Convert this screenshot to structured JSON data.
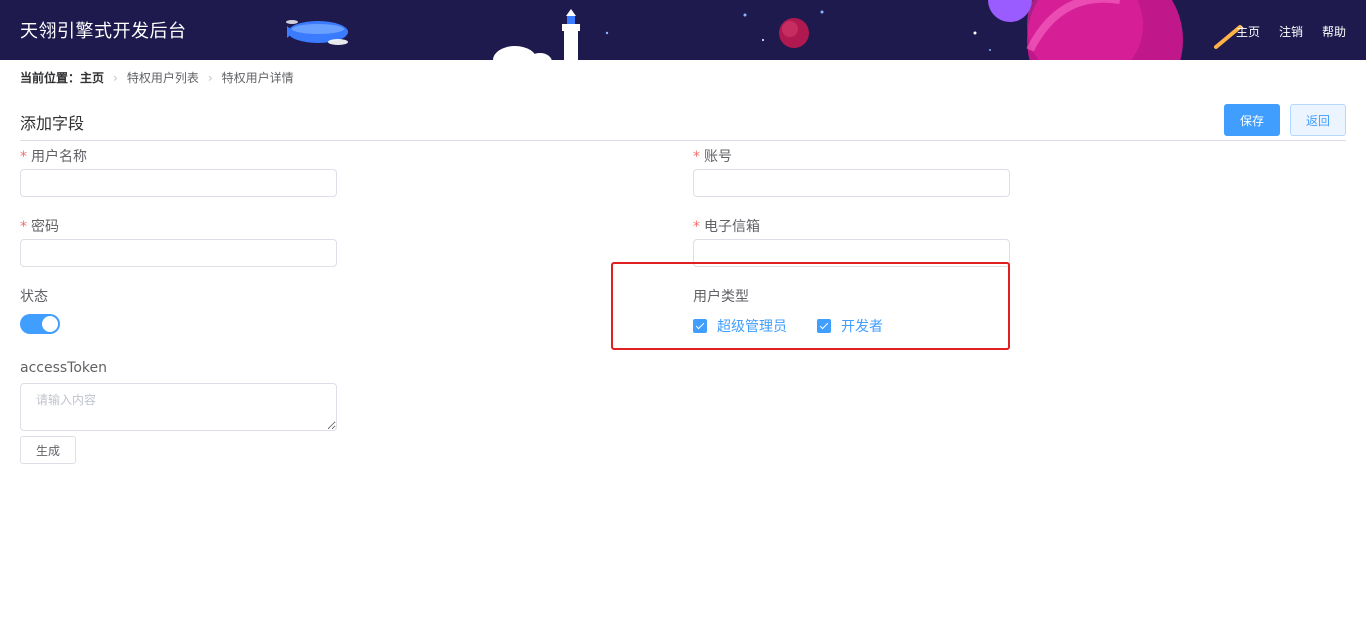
{
  "header": {
    "app_title": "天翎引擎式开发后台",
    "nav": {
      "home": "主页",
      "logout": "注销",
      "help": "帮助"
    }
  },
  "breadcrumb": {
    "label": "当前位置：",
    "home": "主页",
    "items": [
      "特权用户列表",
      "特权用户详情"
    ]
  },
  "section": {
    "title": "添加字段"
  },
  "toolbar": {
    "save_label": "保存",
    "back_label": "返回"
  },
  "form": {
    "username": {
      "label": "用户名称",
      "required": true,
      "value": ""
    },
    "account": {
      "label": "账号",
      "required": true,
      "value": ""
    },
    "password": {
      "label": "密码",
      "required": true,
      "value": ""
    },
    "email": {
      "label": "电子信箱",
      "required": true,
      "value": ""
    },
    "status": {
      "label": "状态",
      "on": true
    },
    "user_type": {
      "label": "用户类型",
      "options": [
        {
          "label": "超级管理员",
          "checked": true
        },
        {
          "label": "开发者",
          "checked": true
        }
      ]
    },
    "access_token": {
      "label": "accessToken",
      "placeholder": "请输入内容",
      "value": ""
    },
    "generate_label": "生成"
  },
  "colors": {
    "header_bg": "#1f1a4d",
    "primary": "#409eff",
    "required": "#f56c6c",
    "highlight": "#e02020"
  }
}
